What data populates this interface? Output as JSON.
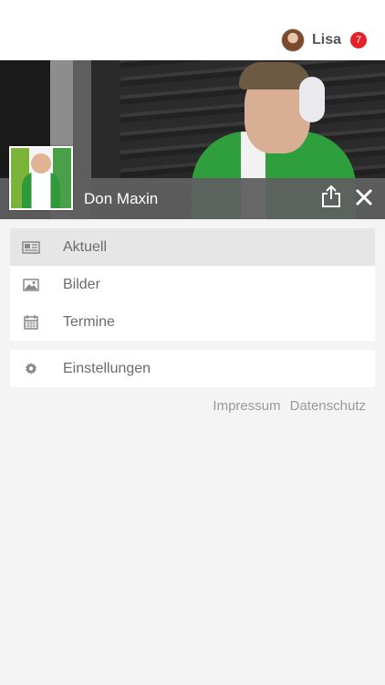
{
  "header": {
    "user_name": "Lisa",
    "notification_count": "7",
    "badge_color": "#e32227"
  },
  "artist": {
    "name": "Don Maxin"
  },
  "menu": {
    "items": [
      {
        "label": "Aktuell",
        "icon": "newspaper-icon",
        "active": true
      },
      {
        "label": "Bilder",
        "icon": "image-icon",
        "active": false
      },
      {
        "label": "Termine",
        "icon": "calendar-icon",
        "active": false
      }
    ],
    "settings_label": "Einstellungen",
    "settings_icon": "gear-icon"
  },
  "footer": {
    "impressum": "Impressum",
    "datenschutz": "Datenschutz"
  }
}
